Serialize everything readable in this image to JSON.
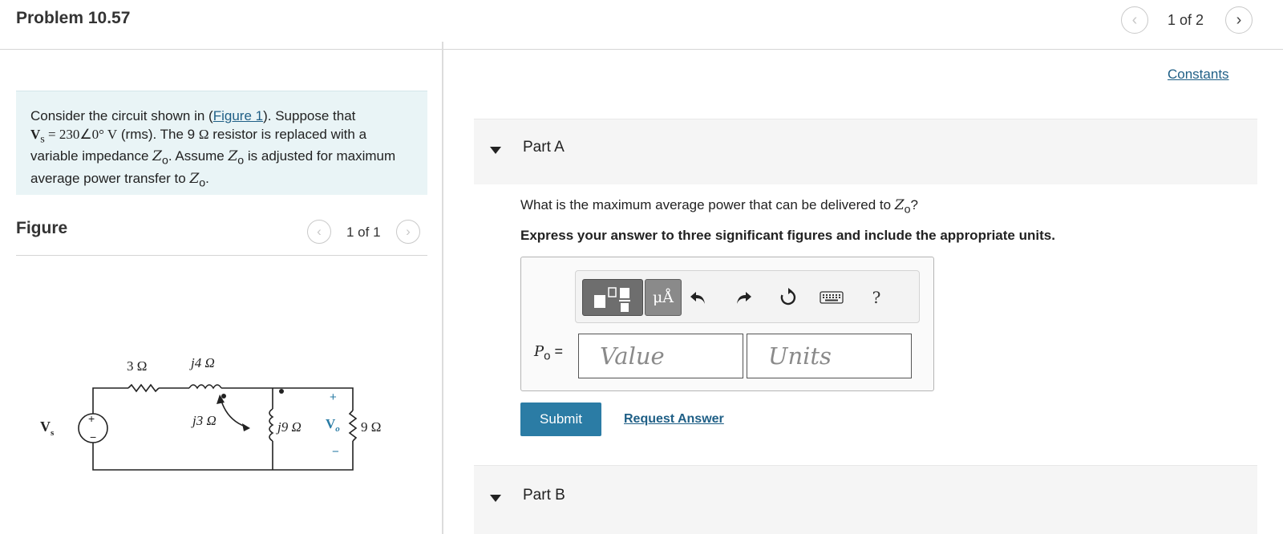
{
  "header": {
    "problem_title": "Problem 10.57",
    "prev_icon": "chevron-left-icon",
    "next_icon": "chevron-right-icon",
    "page_count": "1 of 2",
    "constants_link": "Constants"
  },
  "prompt": {
    "intro": "Consider the circuit shown in (",
    "figure_link": "Figure 1",
    "after_link": "). Suppose that",
    "vs_symbol": "V",
    "vs_sub": "s",
    "vs_value": " = 230∠0° V",
    "rms": " (rms). The 9 ",
    "ohm": "Ω",
    "line2": " resistor is replaced with a variable impedance ",
    "zo": "Z",
    "zo_sub": "o",
    "line3": ". Assume ",
    "line4": " is adjusted for maximum average power transfer to ",
    "end": "."
  },
  "figure": {
    "label": "Figure",
    "count": "1 of 1",
    "circuit": {
      "r1": "3 Ω",
      "l1": "j4 Ω",
      "l2": "j3 Ω",
      "l3": "j9 Ω",
      "vo": "V",
      "vo_sub": "o",
      "r2": "9 Ω",
      "vs": "V",
      "vs_sub": "s",
      "plus": "+",
      "minus": "−"
    }
  },
  "part_a": {
    "title": "Part A",
    "question_pre": "What is the maximum average power that can be delivered to ",
    "question_z": "Z",
    "question_sub": "o",
    "question_post": "?",
    "instruction": "Express your answer to three significant figures and include the appropriate units.",
    "toolbar": {
      "units_label": "μÅ",
      "help_label": "?",
      "icons": [
        "templates-icon",
        "units-icon",
        "undo-icon",
        "redo-icon",
        "reset-icon",
        "keyboard-icon",
        "help-icon"
      ]
    },
    "answer_label": "P",
    "answer_sub": "o",
    "answer_eq": " =",
    "value_placeholder": "Value",
    "units_placeholder": "Units",
    "submit_label": "Submit",
    "request_label": "Request Answer"
  },
  "part_b": {
    "title": "Part B"
  },
  "colors": {
    "accent": "#2b7ca5",
    "link": "#1f5f86",
    "prompt_bg": "#e9f4f6",
    "part_bg": "#f5f5f5"
  }
}
